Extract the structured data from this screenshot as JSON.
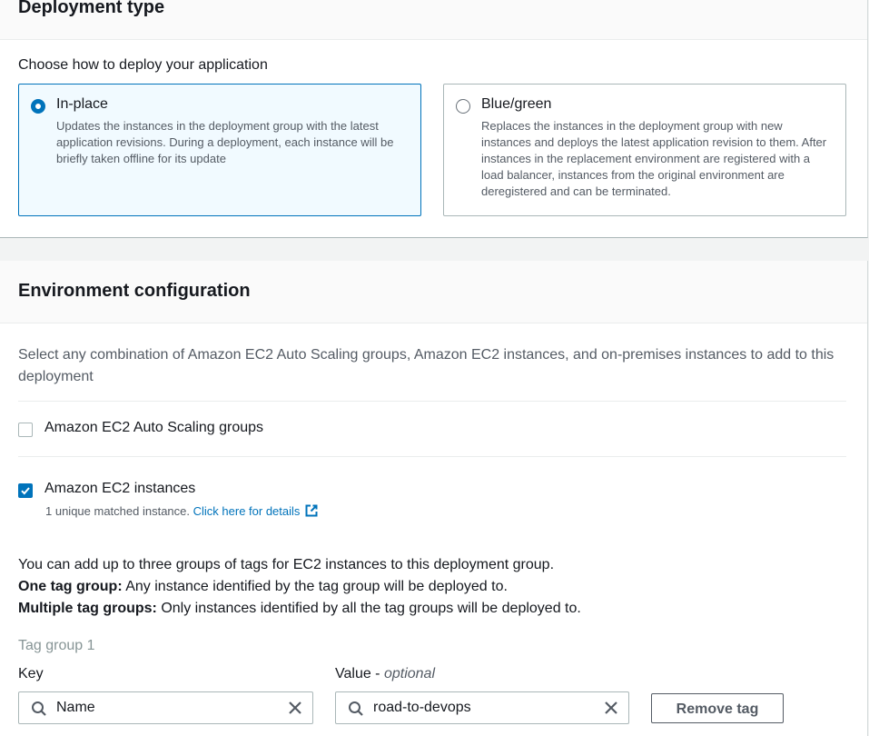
{
  "deployment_type": {
    "title": "Deployment type",
    "prompt": "Choose how to deploy your application",
    "options": [
      {
        "label": "In-place",
        "description": "Updates the instances in the deployment group with the latest application revisions. During a deployment, each instance will be briefly taken offline for its update",
        "selected": true
      },
      {
        "label": "Blue/green",
        "description": "Replaces the instances in the deployment group with new instances and deploys the latest application revision to them. After instances in the replacement environment are registered with a load balancer, instances from the original environment are deregistered and can be terminated.",
        "selected": false
      }
    ]
  },
  "environment": {
    "title": "Environment configuration",
    "description": "Select any combination of Amazon EC2 Auto Scaling groups, Amazon EC2 instances, and on-premises instances to add to this deployment",
    "autoscaling": {
      "label": "Amazon EC2 Auto Scaling groups",
      "checked": false
    },
    "ec2": {
      "label": "Amazon EC2 instances",
      "checked": true,
      "matched_text": "1 unique matched instance.",
      "details_link": "Click here for details"
    },
    "info": {
      "line1": "You can add up to three groups of tags for EC2 instances to this deployment group.",
      "line2_bold": "One tag group:",
      "line2_text": " Any instance identified by the tag group will be deployed to.",
      "line3_bold": "Multiple tag groups:",
      "line3_text": " Only instances identified by all the tag groups will be deployed to."
    },
    "tag_group": {
      "title": "Tag group 1",
      "key_label": "Key",
      "value_label": "Value",
      "value_optional": "optional",
      "key_value": "Name",
      "value_value": "road-to-devops",
      "remove_label": "Remove tag"
    }
  },
  "colors": {
    "accent": "#0073bb",
    "selected_tile_bg": "#f1faff",
    "text": "#16191f",
    "secondary": "#545b64"
  }
}
